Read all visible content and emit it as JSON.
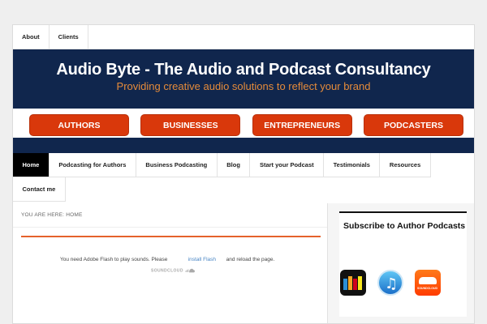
{
  "top_nav": {
    "items": [
      "About",
      "Clients"
    ]
  },
  "banner": {
    "title": "Audio Byte - The Audio and Podcast Consultancy",
    "tagline": "Providing creative audio solutions to reflect your brand"
  },
  "cta_buttons": [
    "AUTHORS",
    "BUSINESSES",
    "ENTREPRENEURS",
    "PODCASTERS"
  ],
  "main_nav": {
    "items": [
      "Home",
      "Podcasting for Authors",
      "Business Podcasting",
      "Blog",
      "Start your Podcast",
      "Testimonials",
      "Resources",
      "Contact me"
    ],
    "active": "Home"
  },
  "breadcrumb": {
    "prefix": "YOU ARE HERE:",
    "current": "HOME"
  },
  "player": {
    "message_before": "You need Adobe Flash to play sounds. Please",
    "link_text": "install Flash",
    "message_after": "and reload the page.",
    "brand": "SOUNDCLOUD"
  },
  "sidebar": {
    "widget_title": "Subscribe to Author Podcasts",
    "icons": [
      "stitcher-icon",
      "itunes-icon",
      "soundcloud-icon"
    ],
    "soundcloud_label": "SOUNDCLOUD"
  },
  "colors": {
    "navy": "#10264d",
    "orange_button": "#d9380b",
    "tagline_orange": "#e58b3a",
    "player_accent": "#e5622b",
    "link_blue": "#4a86c5"
  }
}
